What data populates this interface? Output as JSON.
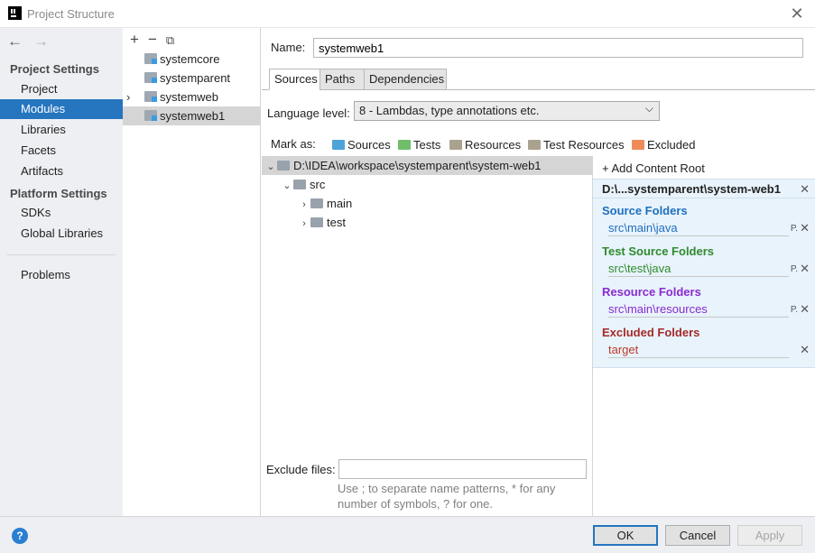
{
  "window": {
    "title": "Project Structure"
  },
  "sidebar": {
    "project_settings_header": "Project Settings",
    "project_settings_items": [
      {
        "label": "Project"
      },
      {
        "label": "Modules",
        "selected": true
      },
      {
        "label": "Libraries"
      },
      {
        "label": "Facets"
      },
      {
        "label": "Artifacts"
      }
    ],
    "platform_settings_header": "Platform Settings",
    "platform_settings_items": [
      {
        "label": "SDKs"
      },
      {
        "label": "Global Libraries"
      }
    ],
    "other_items": [
      {
        "label": "Problems"
      }
    ]
  },
  "modules": {
    "items": [
      {
        "label": "systemcore"
      },
      {
        "label": "systemparent"
      },
      {
        "label": "systemweb",
        "expandable": true
      },
      {
        "label": "systemweb1",
        "selected": true
      }
    ]
  },
  "detail": {
    "name_label": "Name:",
    "name_value": "systemweb1",
    "tabs": [
      {
        "label": "Sources",
        "active": true
      },
      {
        "label": "Paths"
      },
      {
        "label": "Dependencies"
      }
    ],
    "language_level_label": "Language level:",
    "language_level_value": "8 - Lambdas, type annotations etc.",
    "mark_as_label": "Mark as:",
    "mark_as": [
      {
        "label": "Sources",
        "color": "#4ea3d9"
      },
      {
        "label": "Tests",
        "color": "#6fbe6a"
      },
      {
        "label": "Resources",
        "color": "#a9a28e"
      },
      {
        "label": "Test Resources",
        "color": "#a9a28e"
      },
      {
        "label": "Excluded",
        "color": "#ef8b5a"
      }
    ],
    "tree": {
      "root": "D:\\IDEA\\workspace\\systemparent\\system-web1",
      "children": [
        {
          "label": "src"
        },
        {
          "label": "main"
        },
        {
          "label": "test"
        }
      ]
    },
    "exclude_files_label": "Exclude files:",
    "exclude_files_value": "",
    "exclude_hint": "Use ; to separate name patterns, * for any number of symbols, ? for one."
  },
  "content_root": {
    "add_label": "Add Content Root",
    "path": "D:\\...systemparent\\system-web1",
    "groups": [
      {
        "title": "Source Folders",
        "color": "#1f6fbf",
        "path": "src\\main\\java",
        "path_color": "#1f6fbf"
      },
      {
        "title": "Test Source Folders",
        "color": "#2e8b2e",
        "path": "src\\test\\java",
        "path_color": "#2e8b2e"
      },
      {
        "title": "Resource Folders",
        "color": "#8a2bd1",
        "path": "src\\main\\resources",
        "path_color": "#8a2bd1"
      },
      {
        "title": "Excluded Folders",
        "color": "#a52a2a",
        "path": "target",
        "path_color": "#c0392b"
      }
    ]
  },
  "buttons": {
    "ok": "OK",
    "cancel": "Cancel",
    "apply": "Apply"
  }
}
